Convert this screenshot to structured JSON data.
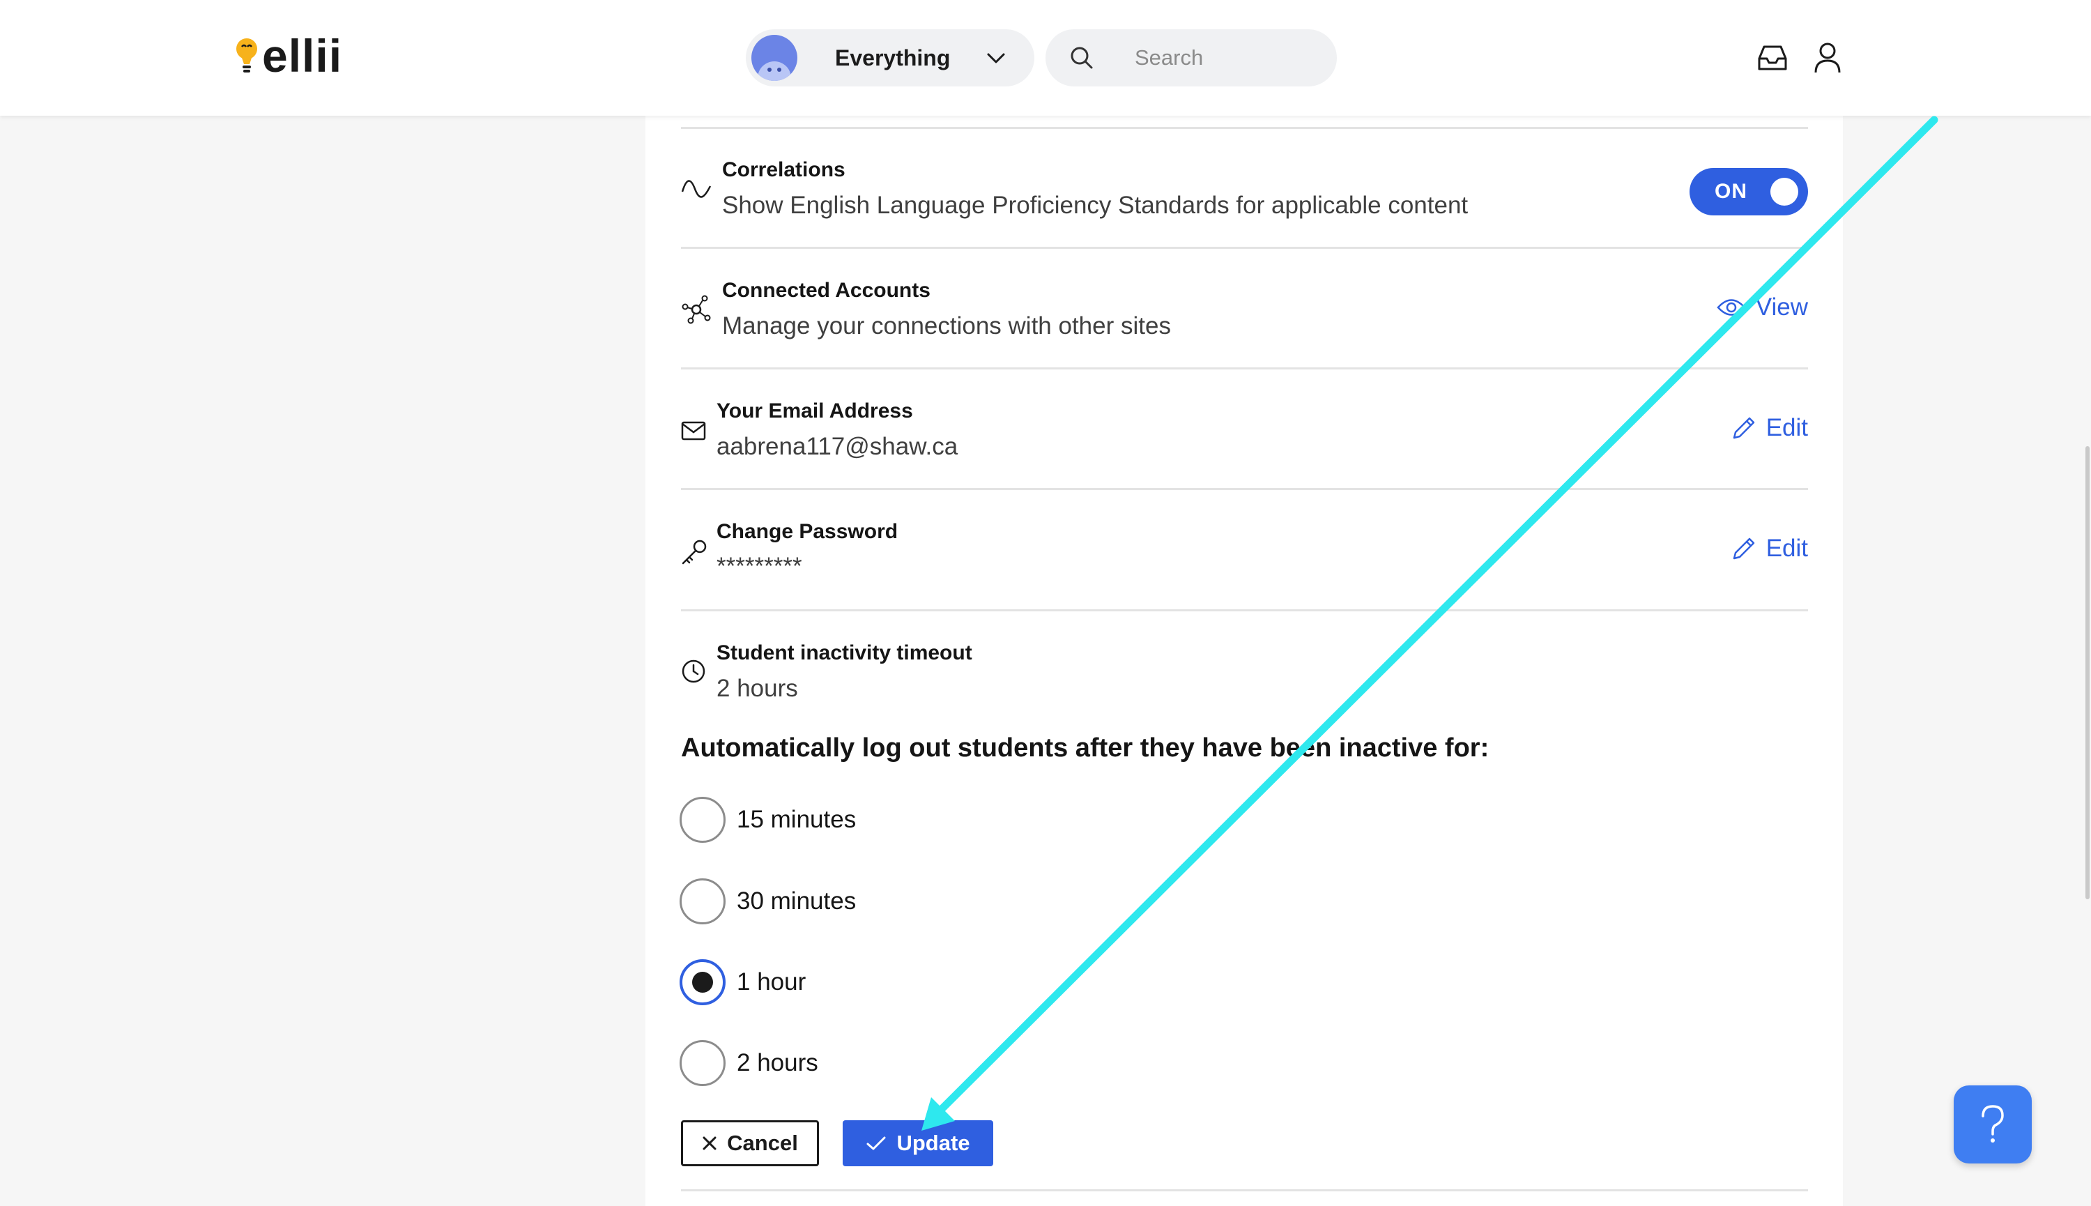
{
  "brand": {
    "name": "ellii"
  },
  "header": {
    "scope_label": "Everything",
    "search_placeholder": "Search"
  },
  "settings": {
    "correlations": {
      "title": "Correlations",
      "subtitle": "Show English Language Proficiency Standards for applicable content",
      "toggle_label": "ON",
      "enabled": true
    },
    "connected_accounts": {
      "title": "Connected Accounts",
      "subtitle": "Manage your connections with other sites",
      "action_label": "View"
    },
    "email": {
      "title": "Your Email Address",
      "value": "aabrena117@shaw.ca",
      "action_label": "Edit"
    },
    "password": {
      "title": "Change Password",
      "value": "*********",
      "action_label": "Edit"
    },
    "inactivity": {
      "title": "Student inactivity timeout",
      "value": "2 hours",
      "question": "Automatically log out students after they have been inactive for:",
      "options": [
        {
          "label": "15 minutes",
          "checked": false
        },
        {
          "label": "30 minutes",
          "checked": false
        },
        {
          "label": "1 hour",
          "checked": true
        },
        {
          "label": "2 hours",
          "checked": false
        }
      ],
      "cancel_label": "Cancel",
      "update_label": "Update"
    }
  },
  "help": {
    "label": "?"
  },
  "colors": {
    "accent": "#2f5fe0",
    "annotation_arrow": "#2ee8ee",
    "help": "#3f7ef2"
  }
}
